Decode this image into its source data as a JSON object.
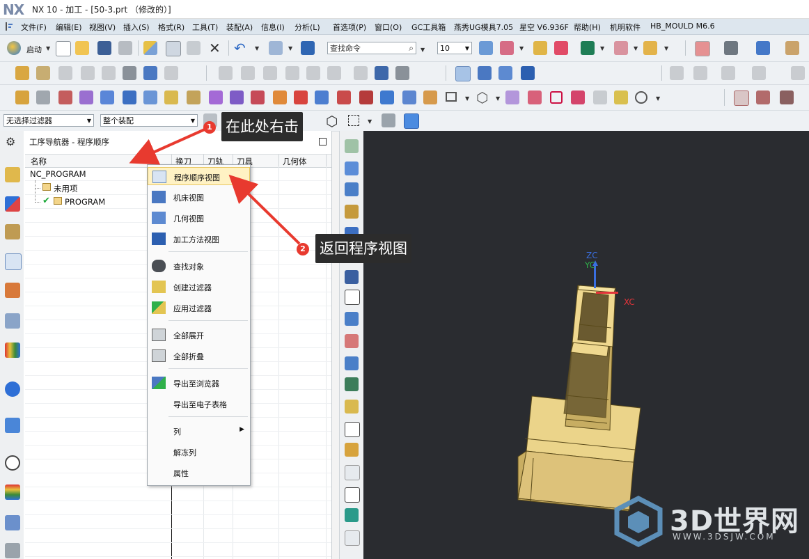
{
  "window": {
    "logo": "NX",
    "title": "NX 10 - 加工 - [50-3.prt （修改的）]"
  },
  "menubar": {
    "items": [
      "文件(F)",
      "编辑(E)",
      "视图(V)",
      "插入(S)",
      "格式(R)",
      "工具(T)",
      "装配(A)",
      "信息(I)",
      "分析(L)",
      "首选项(P)",
      "窗口(O)",
      "GC工具箱",
      "燕秀UG模具7.05",
      "星空 V6.936F",
      "帮助(H)",
      "机明软件",
      "HB_MOULD M6.6"
    ]
  },
  "toolbar": {
    "start_label": "启动",
    "search_command_placeholder": "查找命令",
    "snap_value": "10"
  },
  "filterbar": {
    "selection_filter": "无选择过滤器",
    "assembly_scope": "整个装配"
  },
  "navigator": {
    "title": "工序导航器 - 程序顺序",
    "columns": [
      "名称",
      "换刀",
      "刀轨",
      "刀具",
      "几何体"
    ],
    "tree": [
      {
        "label": "NC_PROGRAM",
        "level": 0
      },
      {
        "label": "未用项",
        "level": 1
      },
      {
        "label": "PROGRAM",
        "level": 1,
        "checked": true
      }
    ]
  },
  "context_menu": {
    "items": [
      {
        "label": "程序顺序视图",
        "icon": "program-order-view-icon",
        "highlighted": true
      },
      {
        "label": "机床视图",
        "icon": "machine-tool-view-icon"
      },
      {
        "label": "几何视图",
        "icon": "geometry-view-icon"
      },
      {
        "label": "加工方法视图",
        "icon": "machining-method-view-icon"
      },
      {
        "label": "查找对象",
        "icon": "binoculars-icon"
      },
      {
        "label": "创建过滤器",
        "icon": "create-filter-icon"
      },
      {
        "label": "应用过滤器",
        "icon": "apply-filter-icon"
      },
      {
        "label": "全部展开",
        "icon": "expand-all-icon"
      },
      {
        "label": "全部折叠",
        "icon": "collapse-all-icon"
      },
      {
        "label": "导出至浏览器",
        "icon": "export-browser-icon"
      },
      {
        "label": "导出至电子表格",
        "icon": ""
      },
      {
        "label": "列",
        "icon": "",
        "submenu": true
      },
      {
        "label": "解冻列",
        "icon": ""
      },
      {
        "label": "属性",
        "icon": ""
      }
    ]
  },
  "callouts": [
    {
      "number": "1",
      "text": "在此处右击"
    },
    {
      "number": "2",
      "text": "返回程序视图"
    }
  ],
  "viewport": {
    "axis_z": "ZC",
    "axis_y": "YC",
    "axis_x": "XC",
    "axis_colors": {
      "z": "#3a6fe0",
      "y": "#2fb04a",
      "x": "#e2343a"
    },
    "model_color": "#e7cd78"
  },
  "watermark": {
    "brand": "3D世界网",
    "url": "WWW.3DSJW.COM"
  }
}
